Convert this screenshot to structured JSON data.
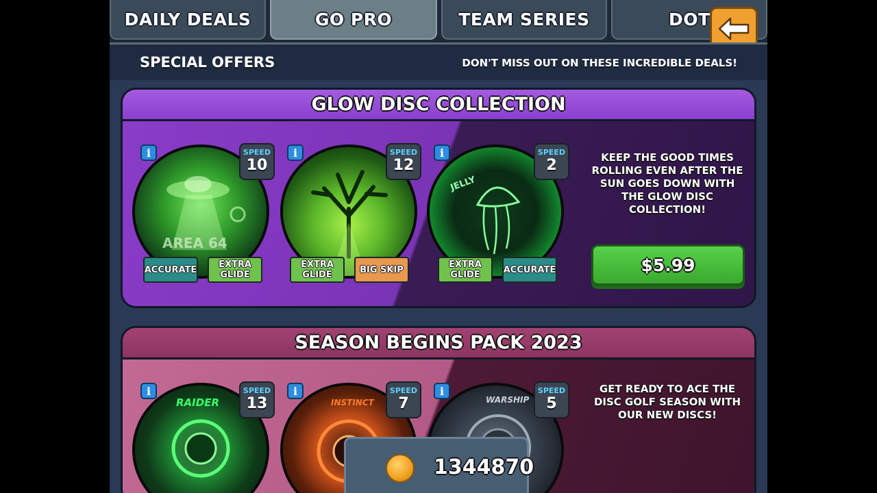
{
  "tabs": [
    "DAILY DEALS",
    "GO PRO",
    "TEAM SERIES",
    "DOTV"
  ],
  "active_tab": "GO PRO",
  "header": {
    "title": "SPECIAL OFFERS",
    "subtitle": "DON'T MISS OUT ON THESE INCREDIBLE DEALS!"
  },
  "offers": [
    {
      "title": "GLOW DISC COLLECTION",
      "description": "KEEP THE GOOD TIMES ROLLING EVEN AFTER THE SUN GOES DOWN WITH THE GLOW DISC COLLECTION!",
      "price": "$5.99",
      "discs": [
        {
          "speed_label": "SPEED",
          "speed": "10",
          "art_text": "AREA 64",
          "tags": [
            "ACCURATE",
            "EXTRA GLIDE"
          ]
        },
        {
          "speed_label": "SPEED",
          "speed": "12",
          "art_text": "",
          "tags": [
            "EXTRA GLIDE",
            "BIG SKIP"
          ]
        },
        {
          "speed_label": "SPEED",
          "speed": "2",
          "art_text": "JELLY",
          "tags": [
            "EXTRA GLIDE",
            "ACCURATE"
          ]
        }
      ]
    },
    {
      "title": "SEASON BEGINS PACK 2023",
      "description": "GET READY TO ACE THE DISC GOLF SEASON WITH OUR NEW DISCS!",
      "discs": [
        {
          "speed_label": "SPEED",
          "speed": "13",
          "art_text": "RAIDER"
        },
        {
          "speed_label": "SPEED",
          "speed": "7",
          "art_text": "INSTINCT"
        },
        {
          "speed_label": "SPEED",
          "speed": "5",
          "art_text": "WARSHIP"
        }
      ]
    }
  ],
  "coins": "1344870",
  "colors": {
    "accent_purple": "#8a3fcf",
    "accent_pink": "#8d3461",
    "buy_green": "#39a92e",
    "back_orange": "#f0a030"
  }
}
